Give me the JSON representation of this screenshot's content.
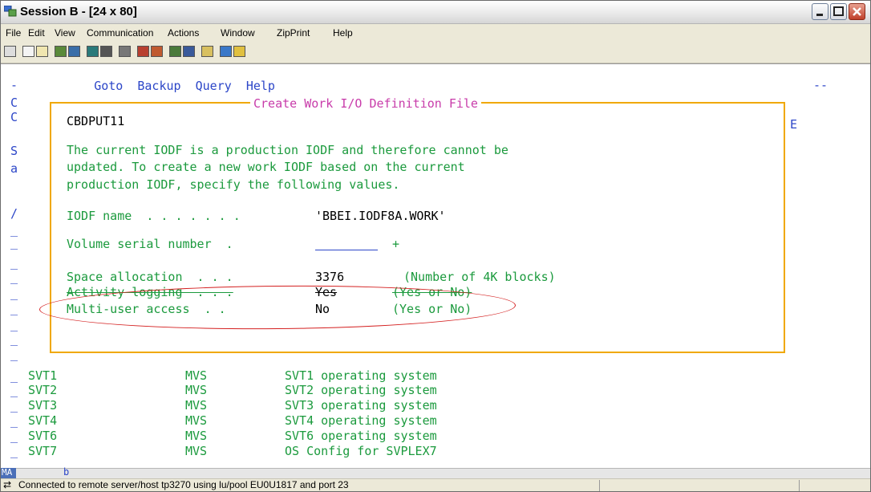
{
  "window": {
    "title": "Session B - [24 x 80]"
  },
  "menubar": [
    "File",
    "Edit",
    "View",
    "Communication",
    "Actions",
    "Window",
    "ZipPrint",
    "Help"
  ],
  "toolbar_icons": [
    "print-screen-icon",
    "copy-icon",
    "paste-icon",
    "send-file-icon",
    "receive-file-icon",
    "display-icon",
    "keypad-icon",
    "color-icon",
    "macro-record-icon",
    "macro-stop-icon",
    "macro-play-icon",
    "macro-edit-icon",
    "clipboard-icon",
    "help-icon",
    "edit-icon"
  ],
  "terminal": {
    "action_bar": [
      "Goto",
      "Backup",
      "Query",
      "Help"
    ],
    "panel_title": "Create Work I/O Definition File",
    "panel_id": "CBDPUT11",
    "message": [
      "The current IODF is a production IODF and therefore cannot be",
      "updated. To create a new work IODF based on the current",
      "production IODF, specify the following values."
    ],
    "iodf_name_label": "IODF name  . . . . . . .",
    "iodf_name_value": "'BBEI.IODF8A.WORK'",
    "volser_label": "Volume serial number  .",
    "volser_value": "",
    "volser_prompt": "+",
    "space_label": "Space allocation  . . .",
    "space_value": "3376",
    "space_hint": "(Number of 4K blocks)",
    "logging_label": "Activity logging  . . .",
    "logging_value": "Yes",
    "logging_hint": "(Yes or No)",
    "multiuser_label": "Multi-user access  . .",
    "multiuser_value": "No",
    "multiuser_hint": "(Yes or No)",
    "left_column": [
      "-",
      "C",
      "C",
      "",
      "S",
      "a",
      "",
      "/",
      "_",
      "_",
      "_",
      "_",
      "_",
      "_",
      "_",
      "_",
      "_"
    ],
    "right_top": "--",
    "right_e": "E",
    "systems": [
      {
        "sel": "_",
        "name": "SVT1",
        "type": "MVS",
        "desc": "SVT1 operating system"
      },
      {
        "sel": "_",
        "name": "SVT2",
        "type": "MVS",
        "desc": "SVT2 operating system"
      },
      {
        "sel": "_",
        "name": "SVT3",
        "type": "MVS",
        "desc": "SVT3 operating system"
      },
      {
        "sel": "_",
        "name": "SVT4",
        "type": "MVS",
        "desc": "SVT4 operating system"
      },
      {
        "sel": "_",
        "name": "SVT6",
        "type": "MVS",
        "desc": "SVT6 operating system"
      },
      {
        "sel": "_",
        "name": "SVT7",
        "type": "MVS",
        "desc": "OS Config for SVPLEX7"
      }
    ]
  },
  "oia": {
    "indicator": "MA",
    "char": "b"
  },
  "status": {
    "text": "Connected to remote server/host tp3270 using lu/pool EU0U1817 and port 23"
  },
  "colors": {
    "field_green": "#1b9a3d",
    "field_blue": "#2c46c8",
    "panel_border": "#f0a800",
    "annotation_red": "#d42020"
  }
}
